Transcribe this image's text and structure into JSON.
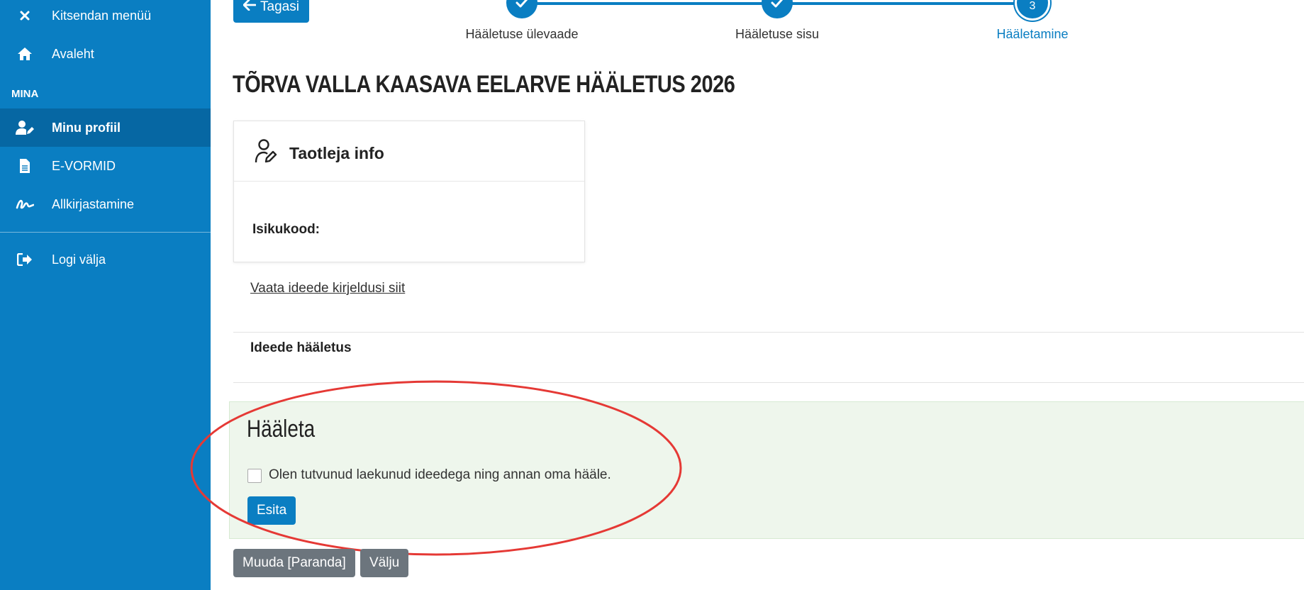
{
  "sidebar": {
    "close_menu_label": "Kitsendan menüü",
    "home_label": "Avaleht",
    "section_title": "MINA",
    "items": [
      {
        "label": "Minu profiil",
        "icon": "user-edit-icon",
        "active": true
      },
      {
        "label": "E-VORMID",
        "icon": "document-icon",
        "active": false
      },
      {
        "label": "Allkirjastamine",
        "icon": "signature-icon",
        "active": false
      }
    ],
    "logout_label": "Logi välja"
  },
  "nav": {
    "back_label": "Tagasi"
  },
  "stepper": {
    "steps": [
      {
        "label": "Hääletuse ülevaade",
        "state": "done"
      },
      {
        "label": "Hääletuse sisu",
        "state": "done"
      },
      {
        "label": "Hääletamine",
        "state": "current",
        "number": "3"
      }
    ]
  },
  "page": {
    "title": "TÕRVA VALLA KAASAVA EELARVE HÄÄLETUS 2026"
  },
  "applicant_card": {
    "title": "Taotleja info",
    "icon": "user-edit-icon",
    "field_label": "Isikukood:"
  },
  "ideas_link": "Vaata ideede kirjeldusi siit",
  "ideas_section_label": "Ideede hääletus",
  "vote": {
    "title": "Hääleta",
    "checkbox_label": "Olen tutvunud laekunud ideedega ning annan oma hääle.",
    "checkbox_checked": false,
    "submit_label": "Esita"
  },
  "footer_buttons": {
    "edit_label": "Muuda [Paranda]",
    "exit_label": "Välju"
  },
  "colors": {
    "brand": "#0a7ec2",
    "sidebar_active": "#0667a3",
    "vote_box_bg": "#eef6ec",
    "secondary_button": "#6c757d",
    "annotation_ellipse": "#e53935"
  }
}
